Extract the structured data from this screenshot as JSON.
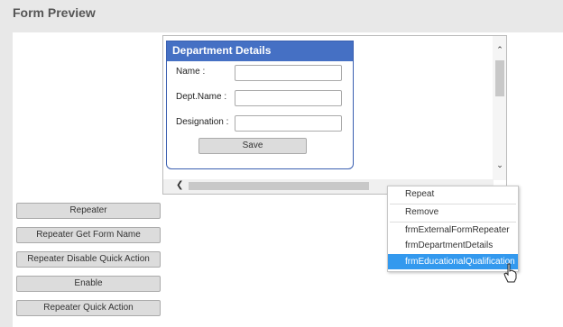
{
  "page": {
    "title": "Form Preview"
  },
  "form": {
    "header": "Department Details",
    "fields": [
      {
        "label": "Name :",
        "value": ""
      },
      {
        "label": "Dept.Name :",
        "value": ""
      },
      {
        "label": "Designation :",
        "value": ""
      }
    ],
    "save_label": "Save"
  },
  "buttons": [
    "Repeater",
    "Repeater Get Form Name",
    "Repeater Disable Quick Action",
    "Enable",
    "Repeater Quick Action"
  ],
  "context_menu": {
    "items": [
      "Repeat",
      "Remove",
      "frmExternalFormRepeater",
      "frmDepartmentDetails",
      "frmEducationalQualification"
    ],
    "highlighted": "frmEducationalQualification",
    "highlight_color": "#3399ee"
  },
  "colors": {
    "form_header": "#4570c4",
    "background": "#e8e8e8"
  }
}
